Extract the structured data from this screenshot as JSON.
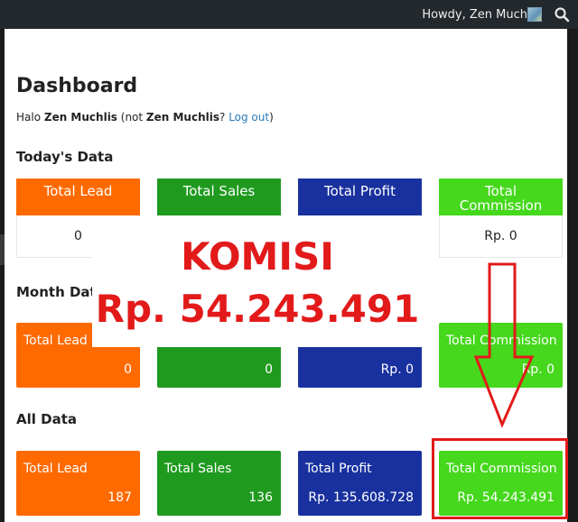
{
  "adminbar": {
    "greeting": "Howdy, Zen Muchlis",
    "avatar_icon": "user-avatar",
    "search_icon": "search-icon"
  },
  "page": {
    "title": "Dashboard",
    "halo_prefix": "Halo ",
    "user_name": "Zen Muchlis",
    "not_prefix": " (not ",
    "not_user": "Zen Muchlis",
    "question": "? ",
    "logout_label": "Log out",
    "close_paren": ")"
  },
  "today": {
    "heading": "Today's Data",
    "cards": [
      {
        "label": "Total Lead",
        "value": "0",
        "color": "#ff6a00"
      },
      {
        "label": "Total Sales",
        "value": "",
        "color": "#1f9a1f"
      },
      {
        "label": "Total Profit",
        "value": "",
        "color": "#19319e"
      },
      {
        "label": "Total Commission",
        "value": "Rp. 0",
        "color": "#45d81c"
      }
    ]
  },
  "month": {
    "heading": "Month Data",
    "tiles": [
      {
        "label": "Total Lead",
        "value": "0",
        "color": "#ff6a00"
      },
      {
        "label": "",
        "value": "0",
        "color": "#1f9a1f"
      },
      {
        "label": "",
        "value": "Rp. 0",
        "color": "#19319e"
      },
      {
        "label": "Total Commission",
        "value": "Rp. 0",
        "color": "#45d81c"
      }
    ]
  },
  "all": {
    "heading": "All Data",
    "tiles": [
      {
        "label": "Total Lead",
        "value": "187",
        "color": "#ff6a00"
      },
      {
        "label": "Total Sales",
        "value": "136",
        "color": "#1f9a1f"
      },
      {
        "label": "Total Profit",
        "value": "Rp. 135.608.728",
        "color": "#19319e"
      },
      {
        "label": "Total Commission",
        "value": "Rp. 54.243.491",
        "color": "#45d81c"
      }
    ]
  },
  "overlay": {
    "line1": "KOMISI",
    "line2": "Rp. 54.243.491",
    "color": "#e21a1a"
  }
}
